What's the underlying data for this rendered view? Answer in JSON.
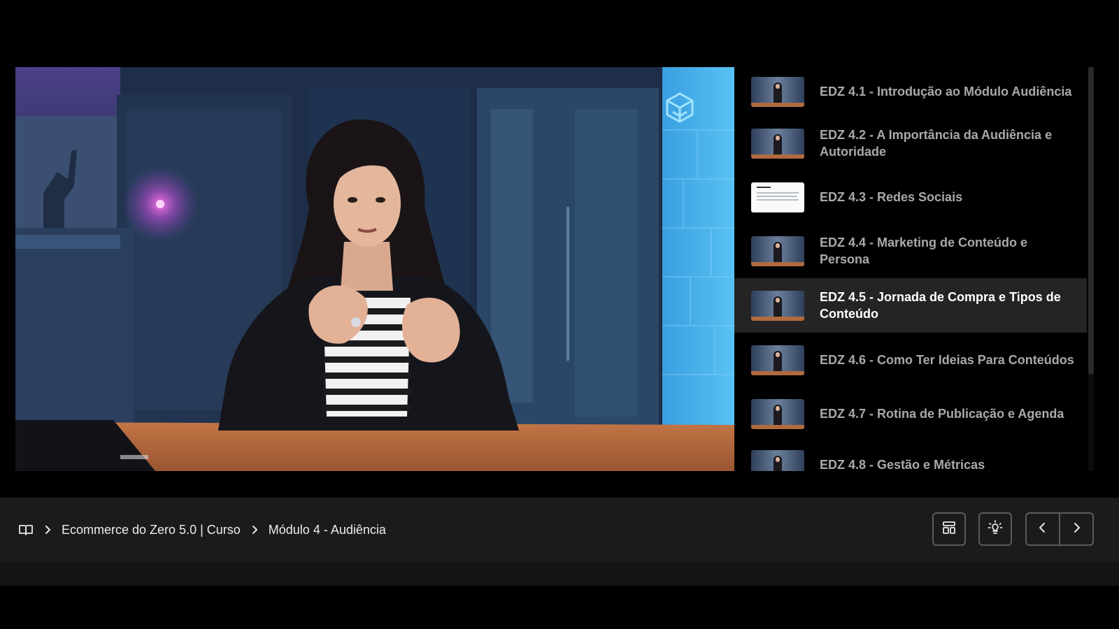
{
  "video": {
    "logo_icon": "cube-logo-icon"
  },
  "playlist": {
    "items": [
      {
        "title": "EDZ 4.1 - Introdução ao Módulo Audiência",
        "thumb": "video"
      },
      {
        "title": "EDZ 4.2 - A Importância da Audiência e Autoridade",
        "thumb": "video"
      },
      {
        "title": "EDZ 4.3 - Redes Sociais",
        "thumb": "document"
      },
      {
        "title": "EDZ 4.4 - Marketing de Conteúdo e Persona",
        "thumb": "video"
      },
      {
        "title": "EDZ 4.5 - Jornada de Compra e Tipos de Conteúdo",
        "thumb": "video",
        "active": true
      },
      {
        "title": "EDZ 4.6 - Como Ter Ideias Para Conteúdos",
        "thumb": "video"
      },
      {
        "title": "EDZ 4.7 - Rotina de Publicação e Agenda",
        "thumb": "video"
      },
      {
        "title": "EDZ 4.8 - Gestão e Métricas",
        "thumb": "video"
      }
    ]
  },
  "breadcrumb": {
    "home_icon": "book-icon",
    "course": "Ecommerce do Zero 5.0 | Curso",
    "module": "Módulo 4 - Audiência"
  },
  "toolbar": {
    "layout_icon": "layout-icon",
    "focus_icon": "lightbulb-icon",
    "prev_icon": "chevron-left-icon",
    "next_icon": "chevron-right-icon"
  },
  "colors": {
    "background": "#000000",
    "bar": "#1b1b1b",
    "active_item": "#242424",
    "text_muted": "#a9a9a9",
    "text_active": "#ffffff"
  }
}
